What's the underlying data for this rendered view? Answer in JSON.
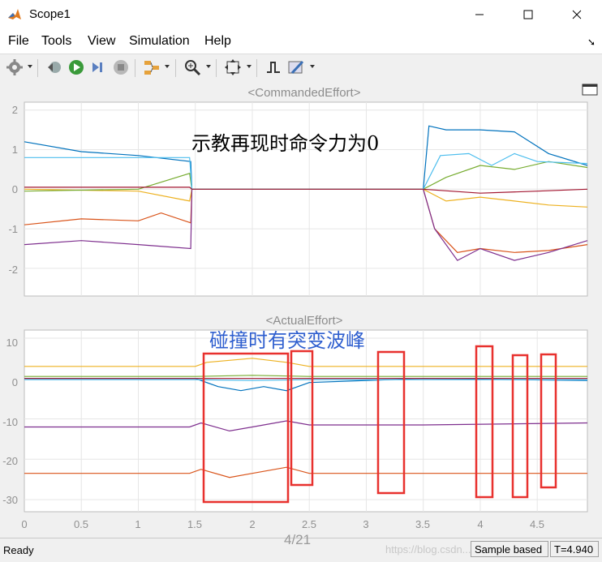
{
  "window": {
    "title": "Scope1"
  },
  "menu": {
    "file": "File",
    "tools": "Tools",
    "view": "View",
    "simulation": "Simulation",
    "help": "Help"
  },
  "plots": {
    "top": {
      "title": "<CommandedEffort>",
      "annotation": "示教再现时命令力为0",
      "yticks": [
        "2",
        "1",
        "0",
        "-1",
        "-2"
      ]
    },
    "bottom": {
      "title": "<ActualEffort>",
      "annotation": "碰撞时有突变波峰",
      "yticks": [
        "10",
        "0",
        "-10",
        "-20",
        "-30"
      ],
      "xticks": [
        "0",
        "0.5",
        "1",
        "1.5",
        "2",
        "2.5",
        "3",
        "3.5",
        "4",
        "4.5"
      ]
    }
  },
  "chart_data": [
    {
      "type": "line",
      "title": "<CommandedEffort>",
      "xlim": [
        0,
        4.94
      ],
      "ylim": [
        -2.7,
        2.2
      ],
      "grid": true,
      "series": [
        {
          "color": "#0072BD",
          "x": [
            0,
            0.5,
            1.0,
            1.46,
            1.47,
            3.5,
            3.55,
            3.7,
            4.0,
            4.3,
            4.6,
            4.94
          ],
          "y": [
            1.2,
            0.95,
            0.85,
            0.7,
            0,
            0,
            1.6,
            1.5,
            1.5,
            1.45,
            0.9,
            0.6
          ]
        },
        {
          "color": "#D95319",
          "x": [
            0,
            0.5,
            1.0,
            1.2,
            1.46,
            1.47,
            3.5,
            3.6,
            3.8,
            4.0,
            4.3,
            4.6,
            4.94
          ],
          "y": [
            -0.9,
            -0.75,
            -0.8,
            -0.6,
            -0.85,
            0,
            0,
            -1.0,
            -1.6,
            -1.5,
            -1.6,
            -1.55,
            -1.4
          ]
        },
        {
          "color": "#EDB120",
          "x": [
            0,
            1.0,
            1.45,
            1.47,
            3.5,
            3.7,
            4.0,
            4.3,
            4.6,
            4.94
          ],
          "y": [
            0.0,
            -0.05,
            -0.3,
            0,
            0,
            -0.3,
            -0.2,
            -0.3,
            -0.4,
            -0.45
          ]
        },
        {
          "color": "#7E2F8E",
          "x": [
            0,
            0.5,
            1.0,
            1.46,
            1.47,
            3.5,
            3.6,
            3.8,
            4.0,
            4.3,
            4.6,
            4.94
          ],
          "y": [
            -1.4,
            -1.3,
            -1.4,
            -1.5,
            0,
            0,
            -1.0,
            -1.8,
            -1.5,
            -1.8,
            -1.6,
            -1.3
          ]
        },
        {
          "color": "#77AC30",
          "x": [
            0,
            1.0,
            1.45,
            1.47,
            3.5,
            3.7,
            4.0,
            4.3,
            4.6,
            4.94
          ],
          "y": [
            -0.05,
            0.0,
            0.4,
            0,
            0,
            0.3,
            0.6,
            0.5,
            0.7,
            0.55
          ]
        },
        {
          "color": "#4DBEEE",
          "x": [
            0,
            1.45,
            1.47,
            3.5,
            3.65,
            3.9,
            4.1,
            4.3,
            4.5,
            4.94
          ],
          "y": [
            0.8,
            0.8,
            0,
            0,
            0.85,
            0.9,
            0.6,
            0.9,
            0.7,
            0.65
          ]
        },
        {
          "color": "#A2142F",
          "x": [
            0,
            1.0,
            1.45,
            1.47,
            3.5,
            4.0,
            4.5,
            4.94
          ],
          "y": [
            0.05,
            0.05,
            0.05,
            0,
            0,
            -0.1,
            -0.05,
            0.0
          ]
        }
      ]
    },
    {
      "type": "line",
      "title": "<ActualEffort>",
      "xlim": [
        0,
        4.94
      ],
      "ylim": [
        -33,
        12
      ],
      "grid": true,
      "series": [
        {
          "color": "#EDB120",
          "x": [
            0,
            1.5,
            1.6,
            2.0,
            2.3,
            2.5,
            3.0,
            4.0,
            4.94
          ],
          "y": [
            3,
            3,
            4,
            5,
            4,
            3,
            3,
            3,
            3
          ]
        },
        {
          "color": "#0072BD",
          "x": [
            0,
            1.5,
            1.7,
            1.9,
            2.1,
            2.3,
            2.5,
            3.5,
            4.94
          ],
          "y": [
            0,
            0,
            -2,
            -3,
            -2,
            -3,
            -1,
            0,
            -0.5
          ]
        },
        {
          "color": "#77AC30",
          "x": [
            0,
            1.5,
            2.0,
            2.5,
            4.94
          ],
          "y": [
            0.5,
            0.5,
            0.8,
            0.5,
            0.5
          ]
        },
        {
          "color": "#4DBEEE",
          "x": [
            0,
            1.5,
            2.0,
            2.5,
            4.94
          ],
          "y": [
            -0.3,
            -0.3,
            -0.5,
            -0.3,
            -0.3
          ]
        },
        {
          "color": "#7E2F8E",
          "x": [
            0,
            1.45,
            1.55,
            1.8,
            2.0,
            2.3,
            2.5,
            3.5,
            4.94
          ],
          "y": [
            -12,
            -12,
            -11,
            -13,
            -12,
            -10.5,
            -11.5,
            -11.5,
            -11
          ]
        },
        {
          "color": "#D95319",
          "x": [
            0,
            1.45,
            1.55,
            1.8,
            2.0,
            2.3,
            2.5,
            3.5,
            4.94
          ],
          "y": [
            -23.5,
            -23.5,
            -22.5,
            -24.5,
            -23.5,
            -22,
            -23.5,
            -23.5,
            -23.5
          ]
        },
        {
          "color": "#A2142F",
          "x": [
            0,
            4.94
          ],
          "y": [
            0,
            0
          ]
        }
      ]
    }
  ]
}
